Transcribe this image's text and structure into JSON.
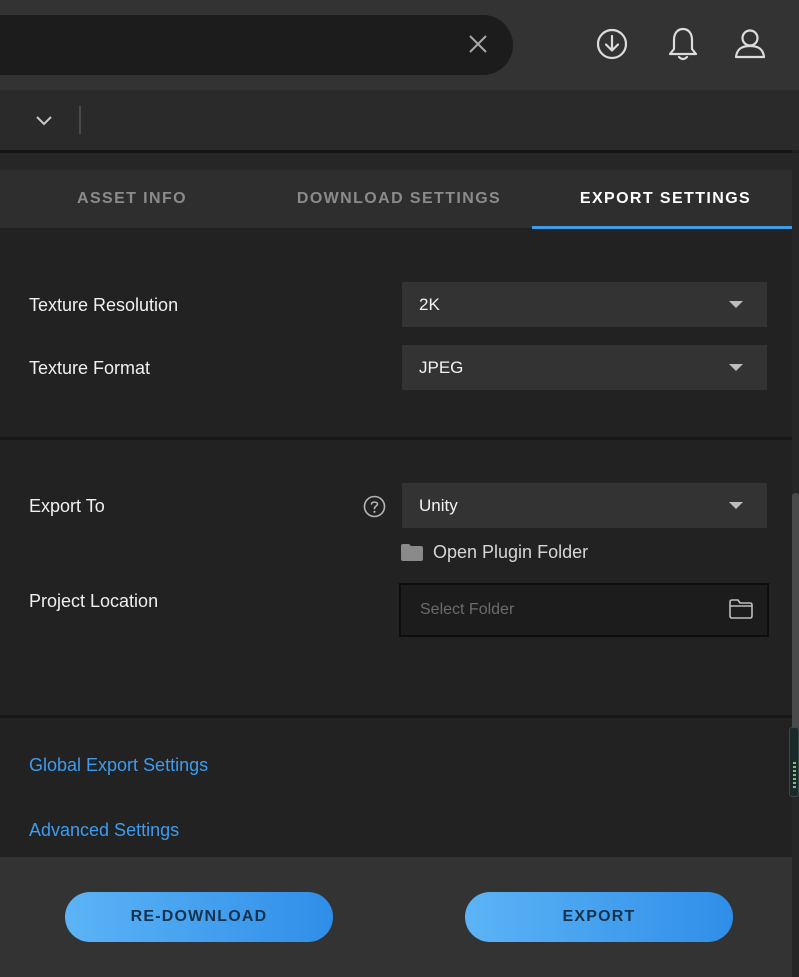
{
  "tabs": {
    "asset_info": "ASSET INFO",
    "download_settings": "DOWNLOAD SETTINGS",
    "export_settings": "EXPORT SETTINGS",
    "active": "EXPORT SETTINGS"
  },
  "texture": {
    "resolution_label": "Texture Resolution",
    "resolution_value": "2K",
    "format_label": "Texture Format",
    "format_value": "JPEG"
  },
  "export": {
    "export_to_label": "Export To",
    "export_to_value": "Unity",
    "open_plugin_folder": "Open Plugin Folder",
    "project_location_label": "Project Location",
    "project_location_placeholder": "Select Folder"
  },
  "links": {
    "global_export_settings": "Global Export Settings",
    "advanced_settings": "Advanced Settings"
  },
  "footer": {
    "redownload_label": "RE-DOWNLOAD",
    "export_label": "EXPORT"
  },
  "icons": {
    "search_clear": "close-icon",
    "downloads": "download-circle-icon",
    "notifications": "bell-icon",
    "account": "user-icon",
    "help": "question-circle-icon",
    "folder": "folder-icon"
  },
  "colors": {
    "accent": "#3d9be9",
    "link": "#3e9cf0",
    "button_gradient_start": "#5cb4f6",
    "button_gradient_end": "#2f8ee8"
  }
}
